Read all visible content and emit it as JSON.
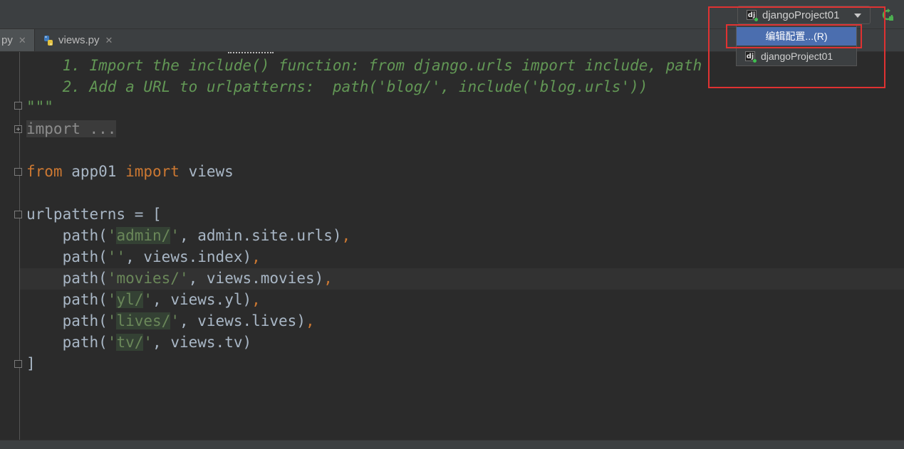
{
  "toolbar": {
    "run_config_label": "djangoProject01",
    "django_icon_glyph": "dj"
  },
  "tabs": [
    {
      "label": "py",
      "close": "✕"
    },
    {
      "label": "views.py",
      "close": "✕"
    }
  ],
  "dropdown": {
    "edit_config_label": "编辑配置...(R)",
    "project_label": "djangoProject01"
  },
  "code": {
    "line1": "    1. Import the include() function: from django.urls import include, path",
    "line2": "    2. Add a URL to urlpatterns:  path('blog/', include('blog.urls'))",
    "line3": "\"\"\"",
    "import_folded": "import ...",
    "from_kw": "from",
    "from_mod": " app01 ",
    "import_kw": "import",
    "import_name": " views",
    "urlpatterns_open": "urlpatterns = [",
    "indent": "    ",
    "path_open": "path(",
    "quote": "'",
    "routes": [
      {
        "route": "admin/",
        "view": ", admin.site.urls)",
        "comma": ","
      },
      {
        "route": "",
        "view": ", views.index)",
        "comma": ","
      },
      {
        "route": "movies/",
        "view": ", views.movies)",
        "comma": ","
      },
      {
        "route": "yl/",
        "view": ", views.yl)",
        "comma": ","
      },
      {
        "route": "lives/",
        "view": ", views.lives)",
        "comma": ","
      },
      {
        "route": "tv/",
        "view": ", views.tv)",
        "comma": ""
      }
    ],
    "close_bracket": "]"
  },
  "colors": {
    "accent_selection": "#4b6eaf",
    "highlight_box": "#e03232",
    "keyword": "#cc7832",
    "string": "#6a8759",
    "comment": "#629755"
  }
}
